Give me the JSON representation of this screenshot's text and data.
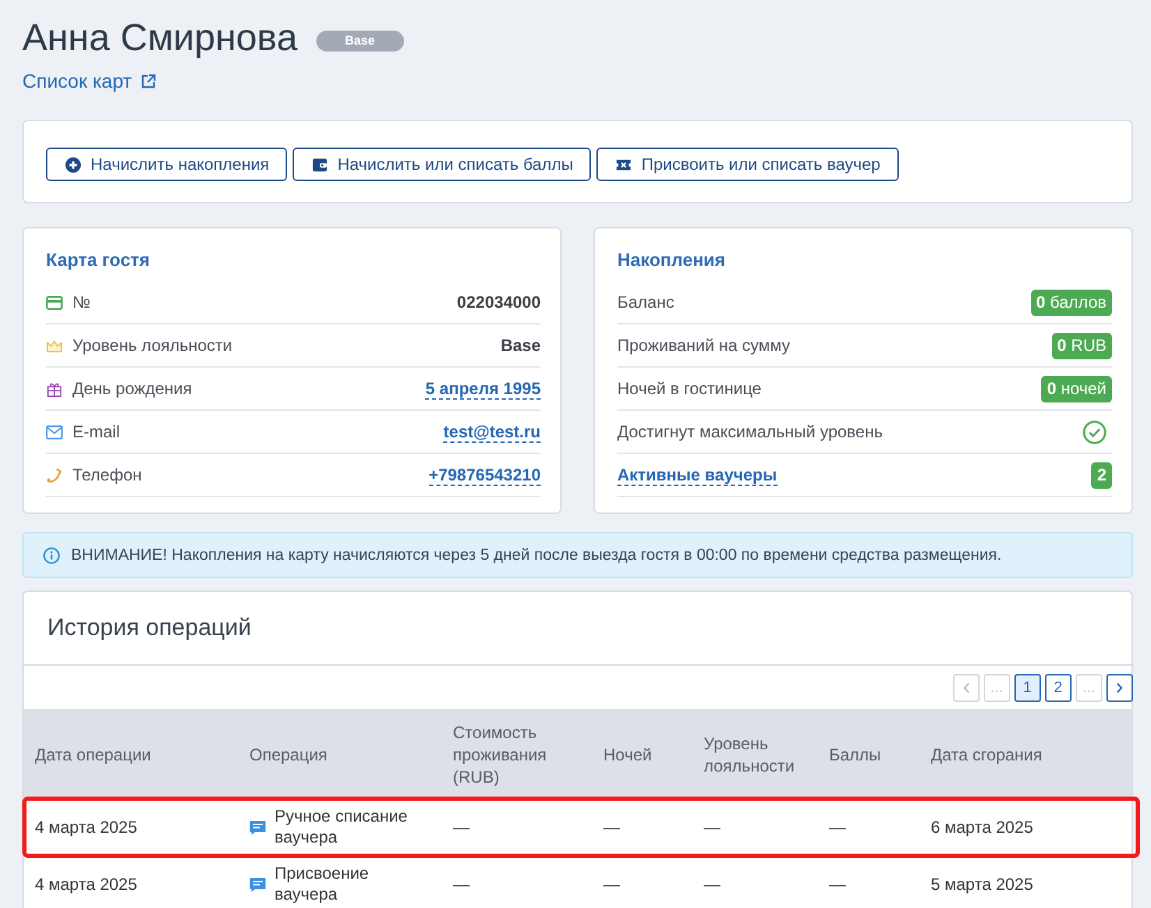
{
  "header": {
    "name": "Анна Смирнова",
    "badge": "Base",
    "link": "Список карт"
  },
  "actions": [
    {
      "kind": "accrue",
      "label": "Начислить накопления"
    },
    {
      "kind": "points",
      "label": "Начислить или списать баллы"
    },
    {
      "kind": "voucher",
      "label": "Присвоить или списать ваучер"
    }
  ],
  "guest_card": {
    "title": "Карта гостя",
    "rows": [
      {
        "kind": "number",
        "label": "№",
        "value": "022034000",
        "link": false
      },
      {
        "kind": "level",
        "label": "Уровень лояльности",
        "value": "Base",
        "link": false
      },
      {
        "kind": "birthday",
        "label": "День рождения",
        "value": "5 апреля 1995",
        "link": true
      },
      {
        "kind": "email",
        "label": "E-mail",
        "value": "test@test.ru",
        "link": true
      },
      {
        "kind": "phone",
        "label": "Телефон",
        "value": "+79876543210",
        "link": true
      }
    ]
  },
  "savings": {
    "title": "Накопления",
    "rows": [
      {
        "kind": "amount",
        "label": "Баланс",
        "value": "**0** баллов"
      },
      {
        "kind": "amount",
        "label": "Проживаний на сумму",
        "value": "**0** RUB"
      },
      {
        "kind": "amount",
        "label": "Ночей в гостинице",
        "value": "**0** ночей"
      },
      {
        "kind": "check",
        "label": "Достигнут максимальный уровень",
        "checked": true
      },
      {
        "kind": "count",
        "label": "Активные ваучеры",
        "value": "2"
      }
    ]
  },
  "notice": {
    "text": "ВНИМАНИЕ! Накопления на карту начисляются через 5 дней после выезда гостя в 00:00 по времени средства размещения."
  },
  "history": {
    "title": "История операций",
    "pagination": [
      {
        "kind": "prev",
        "disabled": true,
        "selected": false
      },
      {
        "kind": "gap",
        "label": "...",
        "disabled": true,
        "selected": false
      },
      {
        "kind": "page",
        "label": "1",
        "disabled": false,
        "selected": true
      },
      {
        "kind": "page",
        "label": "2",
        "disabled": false,
        "selected": false
      },
      {
        "kind": "gap",
        "label": "...",
        "disabled": true,
        "selected": false
      },
      {
        "kind": "next",
        "disabled": false,
        "selected": false
      }
    ],
    "columns": [
      "Дата операции",
      "Операция",
      "Стоимость проживания (RUB)",
      "Ночей",
      "Уровень лояльности",
      "Баллы",
      "Дата сгорания"
    ],
    "rows": [
      {
        "date": "4 марта 2025",
        "operation": "Ручное списание ваучера",
        "cost": "—",
        "nights": "—",
        "level": "—",
        "points": "—",
        "expires": "6 марта 2025",
        "highlighted": true
      },
      {
        "date": "4 марта 2025",
        "operation": "Присвоение ваучера",
        "cost": "—",
        "nights": "—",
        "level": "—",
        "points": "—",
        "expires": "5 марта 2025",
        "highlighted": false
      }
    ]
  }
}
